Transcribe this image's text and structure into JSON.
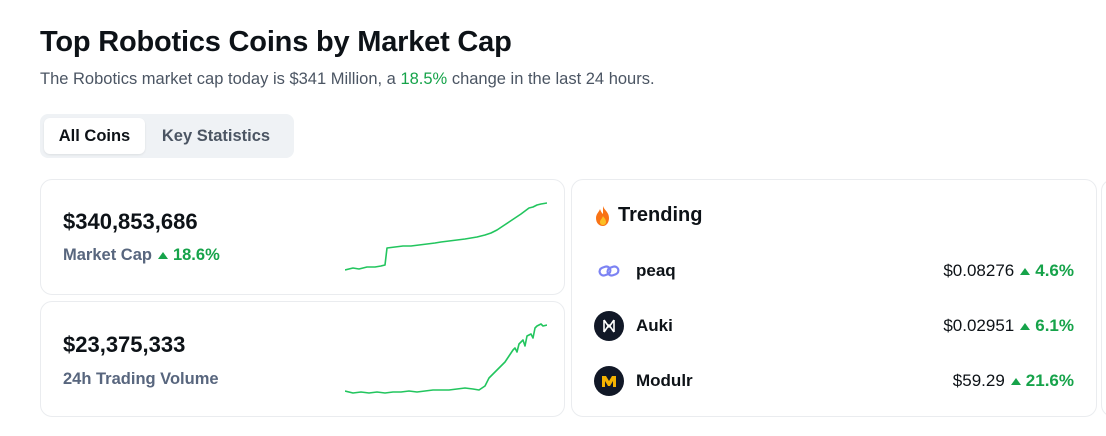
{
  "header": {
    "title": "Top Robotics Coins by Market Cap",
    "subtitle_before": "The Robotics market cap today is $341 Million, a",
    "subtitle_change": "18.5%",
    "subtitle_after": "change in the last 24 hours."
  },
  "tabs": [
    {
      "label": "All Coins",
      "active": true
    },
    {
      "label": "Key Statistics",
      "active": false
    }
  ],
  "stats": {
    "market_cap": {
      "value": "$340,853,686",
      "label": "Market Cap",
      "change": "18.6%",
      "direction": "up"
    },
    "volume": {
      "value": "$23,375,333",
      "label": "24h Trading Volume"
    }
  },
  "trending": {
    "title": "Trending",
    "icon": "fire-icon",
    "coins": [
      {
        "name": "peaq",
        "icon": "peaq-logo-icon",
        "price": "$0.08276",
        "change": "4.6%",
        "direction": "up"
      },
      {
        "name": "Auki",
        "icon": "auki-logo-icon",
        "price": "$0.02951",
        "change": "6.1%",
        "direction": "up"
      },
      {
        "name": "Modulr",
        "icon": "modulr-logo-icon",
        "price": "$59.29",
        "change": "21.6%",
        "direction": "up"
      }
    ]
  },
  "colors": {
    "positive": "#16a34a",
    "sparkline": "#22c55e",
    "muted_text": "#58667e"
  }
}
